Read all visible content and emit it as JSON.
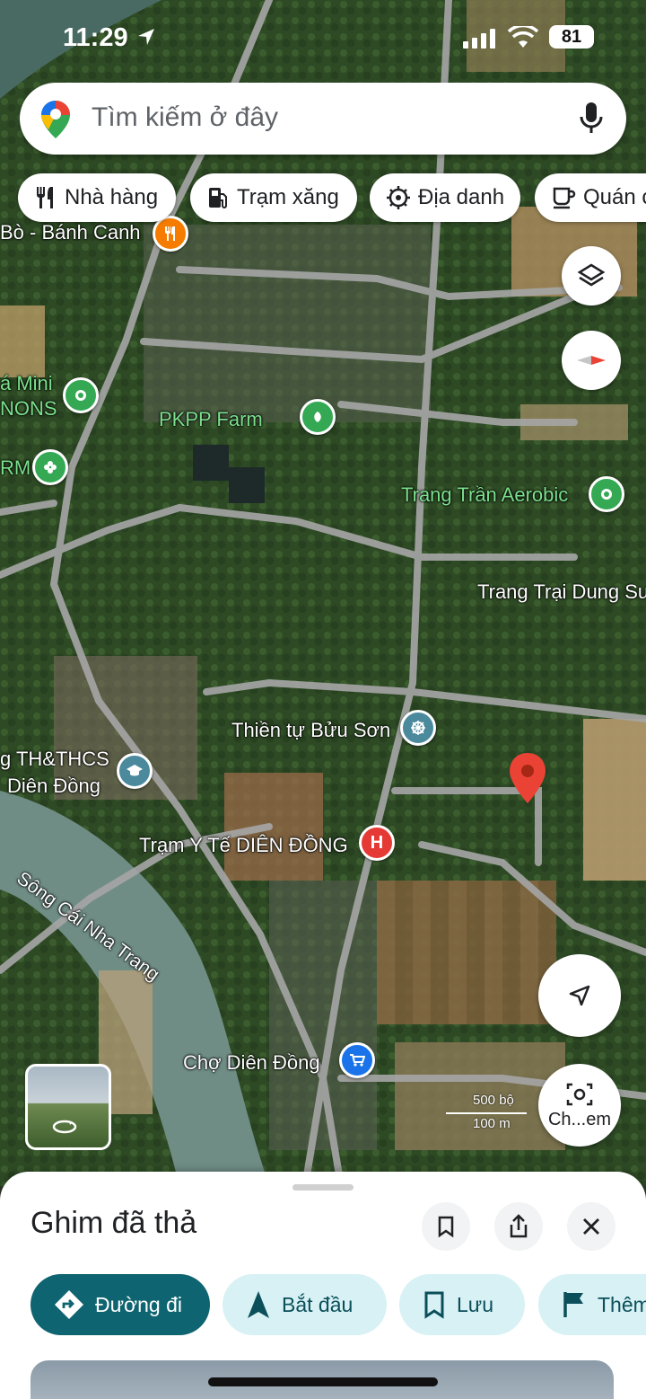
{
  "status": {
    "time": "11:29",
    "battery": "81"
  },
  "search": {
    "placeholder": "Tìm kiếm ở đây"
  },
  "chips": [
    {
      "label": "Nhà hàng",
      "icon": "fork-knife-icon"
    },
    {
      "label": "Trạm xăng",
      "icon": "gas-station-icon"
    },
    {
      "label": "Địa danh",
      "icon": "landmark-icon"
    },
    {
      "label": "Quán c",
      "icon": "coffee-icon"
    }
  ],
  "map": {
    "labels": {
      "bo_banh_canh": "Bò - Bánh Canh",
      "mini_1": "á Mini",
      "mini_2": "NONS",
      "pkpp": "PKPP Farm",
      "rm": "RM",
      "aerobic": "Trang Trần Aerobic",
      "trang_trai": "Trang Trại Dung Su",
      "thien_tu": "Thiền tự Bửu Sơn",
      "school_1": "g TH&THCS",
      "school_2": "Diên Đồng",
      "song": "Sông Cái Nha Trang",
      "tram_y_te": "Trạm Y Tế DIÊN ĐỒNG",
      "cho": "Chợ Diên Đồng"
    },
    "scale": {
      "top": "500 bộ",
      "bottom": "100 m"
    },
    "camera_label": "Ch...em",
    "colors": {
      "restaurant": "#f57c00",
      "park": "#34a853",
      "place": "#4a8a9c",
      "hospital": "#e53935",
      "shopping": "#1a73e8",
      "pin": "#ea4335"
    }
  },
  "sheet": {
    "title": "Ghim đã thả",
    "actions": [
      {
        "label": "Đường đi",
        "icon": "directions-icon"
      },
      {
        "label": "Bắt đầu",
        "icon": "navigation-arrow-icon"
      },
      {
        "label": "Lưu",
        "icon": "bookmark-icon"
      },
      {
        "label": "Thêm",
        "icon": "flag-icon"
      }
    ]
  }
}
